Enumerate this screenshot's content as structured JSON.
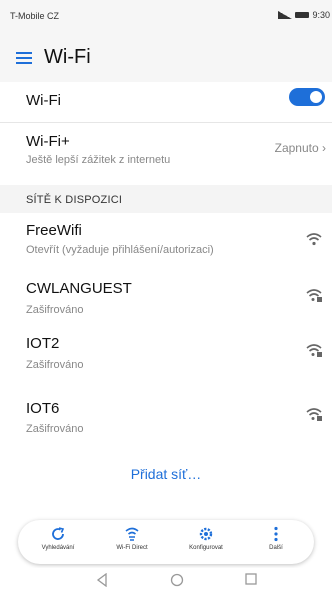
{
  "status_bar": {
    "carrier": "T-Mobile CZ",
    "indicators": "N ᐧ 9:30"
  },
  "header": {
    "title": "Wi-Fi",
    "menu_icon": "hamburger-icon"
  },
  "wifi_toggle": {
    "label": "Wi-Fi",
    "state": "on"
  },
  "wifi_plus": {
    "title": "Wi-Fi+",
    "subtitle": "Ještě lepší zážitek z internetu",
    "value": "Zapnuto"
  },
  "section": {
    "label": "SÍTĚ K DISPOZICI"
  },
  "networks": [
    {
      "name": "FreeWifi",
      "status": "Otevřít (vyžaduje přihlášení/autorizaci)",
      "icon": "wifi-open-icon"
    },
    {
      "name": "CWLANGUEST",
      "status": "Zašifrováno",
      "icon": "wifi-locked-icon"
    },
    {
      "name": "IOT2",
      "status": "Zašifrováno",
      "icon": "wifi-locked-icon"
    },
    {
      "name": "IOT6",
      "status": "Zašifrováno",
      "icon": "wifi-locked-icon"
    }
  ],
  "add_network": {
    "label": "Přidat síť…"
  },
  "toolbar": {
    "scan": "Vyhledávání",
    "wifi_direct": "Wi-Fi Direct",
    "configure": "Konfigurovat",
    "more": "Další"
  },
  "colors": {
    "accent": "#1e6fd9",
    "brand_mark": "#e0218a"
  }
}
